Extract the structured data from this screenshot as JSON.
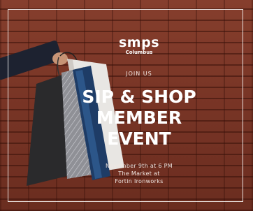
{
  "logo": {
    "name": "smps",
    "city": "Columbus"
  },
  "invite": "JOIN US",
  "headline": [
    "SIP & SHOP",
    "MEMBER",
    "EVENT"
  ],
  "details": [
    "November 9th at 6 PM",
    "The Market at",
    "Fortin Ironworks"
  ],
  "colors": {
    "brick": "#8e4130",
    "frame": "#ffffff",
    "text": "#ffffff"
  }
}
